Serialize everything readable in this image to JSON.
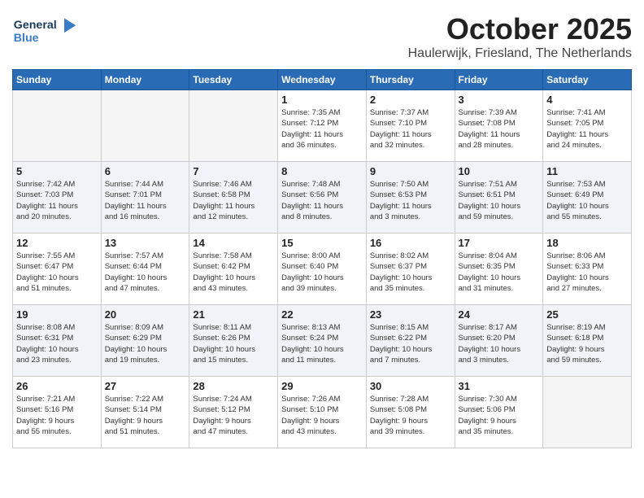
{
  "header": {
    "logo_line1": "General",
    "logo_line2": "Blue",
    "month": "October 2025",
    "location": "Haulerwijk, Friesland, The Netherlands"
  },
  "days_of_week": [
    "Sunday",
    "Monday",
    "Tuesday",
    "Wednesday",
    "Thursday",
    "Friday",
    "Saturday"
  ],
  "weeks": [
    [
      {
        "day": "",
        "info": ""
      },
      {
        "day": "",
        "info": ""
      },
      {
        "day": "",
        "info": ""
      },
      {
        "day": "1",
        "info": "Sunrise: 7:35 AM\nSunset: 7:12 PM\nDaylight: 11 hours\nand 36 minutes."
      },
      {
        "day": "2",
        "info": "Sunrise: 7:37 AM\nSunset: 7:10 PM\nDaylight: 11 hours\nand 32 minutes."
      },
      {
        "day": "3",
        "info": "Sunrise: 7:39 AM\nSunset: 7:08 PM\nDaylight: 11 hours\nand 28 minutes."
      },
      {
        "day": "4",
        "info": "Sunrise: 7:41 AM\nSunset: 7:05 PM\nDaylight: 11 hours\nand 24 minutes."
      }
    ],
    [
      {
        "day": "5",
        "info": "Sunrise: 7:42 AM\nSunset: 7:03 PM\nDaylight: 11 hours\nand 20 minutes."
      },
      {
        "day": "6",
        "info": "Sunrise: 7:44 AM\nSunset: 7:01 PM\nDaylight: 11 hours\nand 16 minutes."
      },
      {
        "day": "7",
        "info": "Sunrise: 7:46 AM\nSunset: 6:58 PM\nDaylight: 11 hours\nand 12 minutes."
      },
      {
        "day": "8",
        "info": "Sunrise: 7:48 AM\nSunset: 6:56 PM\nDaylight: 11 hours\nand 8 minutes."
      },
      {
        "day": "9",
        "info": "Sunrise: 7:50 AM\nSunset: 6:53 PM\nDaylight: 11 hours\nand 3 minutes."
      },
      {
        "day": "10",
        "info": "Sunrise: 7:51 AM\nSunset: 6:51 PM\nDaylight: 10 hours\nand 59 minutes."
      },
      {
        "day": "11",
        "info": "Sunrise: 7:53 AM\nSunset: 6:49 PM\nDaylight: 10 hours\nand 55 minutes."
      }
    ],
    [
      {
        "day": "12",
        "info": "Sunrise: 7:55 AM\nSunset: 6:47 PM\nDaylight: 10 hours\nand 51 minutes."
      },
      {
        "day": "13",
        "info": "Sunrise: 7:57 AM\nSunset: 6:44 PM\nDaylight: 10 hours\nand 47 minutes."
      },
      {
        "day": "14",
        "info": "Sunrise: 7:58 AM\nSunset: 6:42 PM\nDaylight: 10 hours\nand 43 minutes."
      },
      {
        "day": "15",
        "info": "Sunrise: 8:00 AM\nSunset: 6:40 PM\nDaylight: 10 hours\nand 39 minutes."
      },
      {
        "day": "16",
        "info": "Sunrise: 8:02 AM\nSunset: 6:37 PM\nDaylight: 10 hours\nand 35 minutes."
      },
      {
        "day": "17",
        "info": "Sunrise: 8:04 AM\nSunset: 6:35 PM\nDaylight: 10 hours\nand 31 minutes."
      },
      {
        "day": "18",
        "info": "Sunrise: 8:06 AM\nSunset: 6:33 PM\nDaylight: 10 hours\nand 27 minutes."
      }
    ],
    [
      {
        "day": "19",
        "info": "Sunrise: 8:08 AM\nSunset: 6:31 PM\nDaylight: 10 hours\nand 23 minutes."
      },
      {
        "day": "20",
        "info": "Sunrise: 8:09 AM\nSunset: 6:29 PM\nDaylight: 10 hours\nand 19 minutes."
      },
      {
        "day": "21",
        "info": "Sunrise: 8:11 AM\nSunset: 6:26 PM\nDaylight: 10 hours\nand 15 minutes."
      },
      {
        "day": "22",
        "info": "Sunrise: 8:13 AM\nSunset: 6:24 PM\nDaylight: 10 hours\nand 11 minutes."
      },
      {
        "day": "23",
        "info": "Sunrise: 8:15 AM\nSunset: 6:22 PM\nDaylight: 10 hours\nand 7 minutes."
      },
      {
        "day": "24",
        "info": "Sunrise: 8:17 AM\nSunset: 6:20 PM\nDaylight: 10 hours\nand 3 minutes."
      },
      {
        "day": "25",
        "info": "Sunrise: 8:19 AM\nSunset: 6:18 PM\nDaylight: 9 hours\nand 59 minutes."
      }
    ],
    [
      {
        "day": "26",
        "info": "Sunrise: 7:21 AM\nSunset: 5:16 PM\nDaylight: 9 hours\nand 55 minutes."
      },
      {
        "day": "27",
        "info": "Sunrise: 7:22 AM\nSunset: 5:14 PM\nDaylight: 9 hours\nand 51 minutes."
      },
      {
        "day": "28",
        "info": "Sunrise: 7:24 AM\nSunset: 5:12 PM\nDaylight: 9 hours\nand 47 minutes."
      },
      {
        "day": "29",
        "info": "Sunrise: 7:26 AM\nSunset: 5:10 PM\nDaylight: 9 hours\nand 43 minutes."
      },
      {
        "day": "30",
        "info": "Sunrise: 7:28 AM\nSunset: 5:08 PM\nDaylight: 9 hours\nand 39 minutes."
      },
      {
        "day": "31",
        "info": "Sunrise: 7:30 AM\nSunset: 5:06 PM\nDaylight: 9 hours\nand 35 minutes."
      },
      {
        "day": "",
        "info": ""
      }
    ]
  ]
}
